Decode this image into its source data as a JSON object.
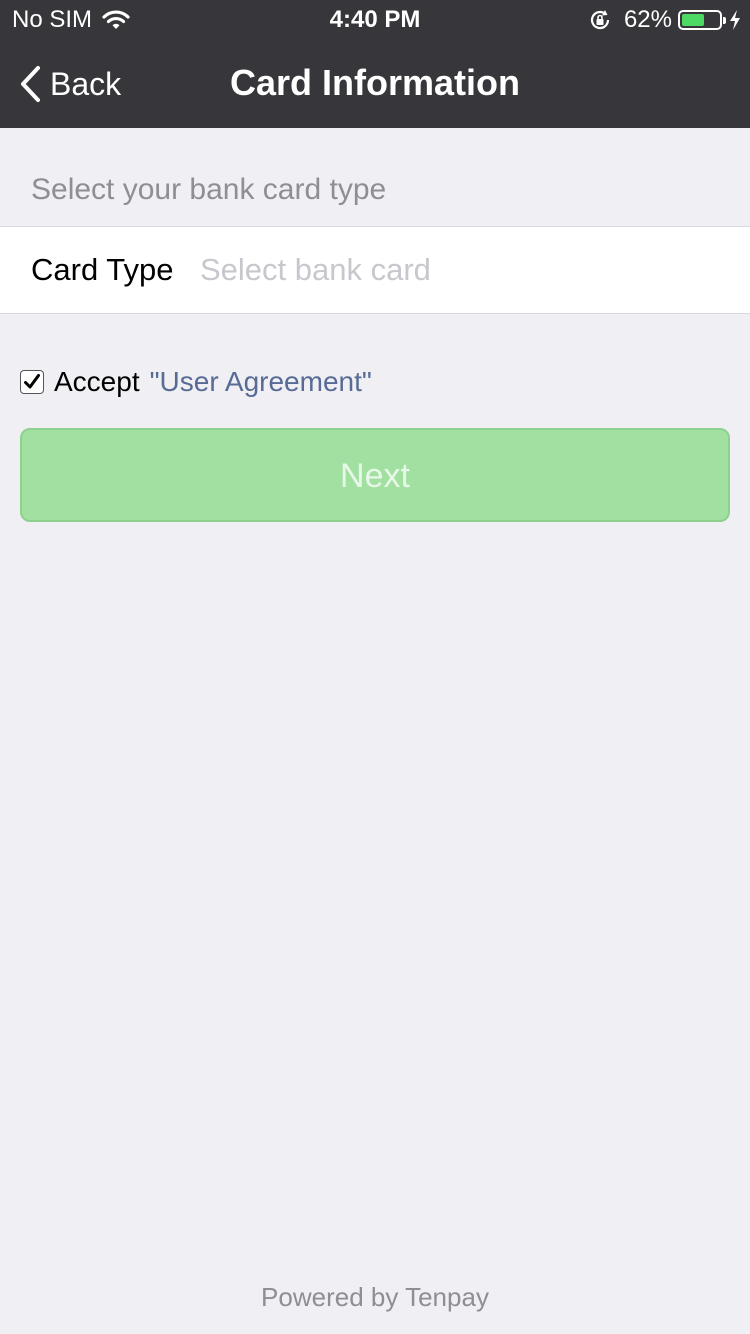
{
  "status_bar": {
    "carrier": "No SIM",
    "time": "4:40 PM",
    "battery_percent": "62%",
    "battery_level": 0.62,
    "battery_color": "#4cd964",
    "icons": [
      "wifi-icon",
      "lock-rotation-icon",
      "battery-icon",
      "charging-icon"
    ]
  },
  "nav": {
    "back_label": "Back",
    "back_icon": "chevron-left-icon",
    "title": "Card Information",
    "background_color": "#37373b"
  },
  "form": {
    "section_hint": "Select your bank card type",
    "card_type_label": "Card Type",
    "card_type_placeholder": "Select bank card",
    "card_type_value": ""
  },
  "agreement": {
    "checked": true,
    "accept_label": "Accept",
    "link_text": "\"User Agreement\"",
    "link_color": "#576b95"
  },
  "actions": {
    "next_label": "Next",
    "next_color": "#a2e0a2"
  },
  "footer": {
    "text": "Powered by Tenpay"
  }
}
